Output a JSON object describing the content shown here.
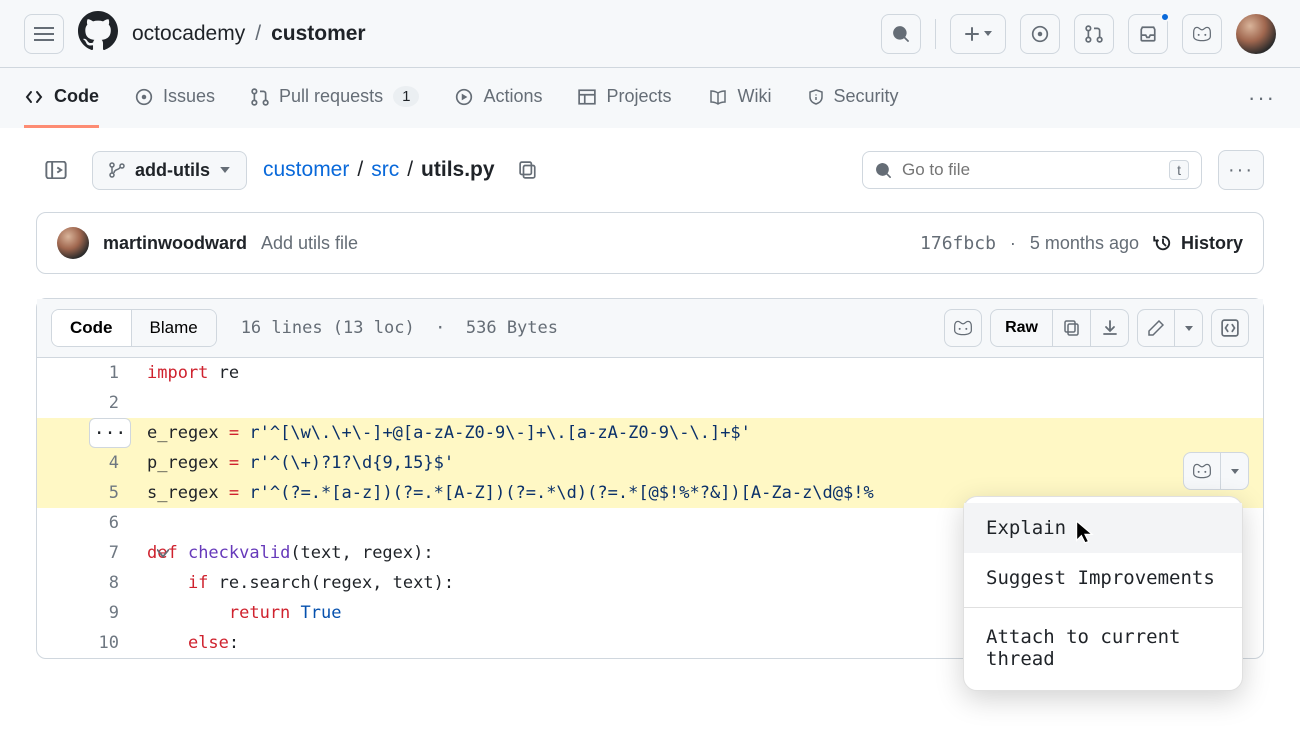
{
  "header": {
    "owner": "octocademy",
    "repo": "customer"
  },
  "tabs": {
    "code": "Code",
    "issues": "Issues",
    "pull_requests": "Pull requests",
    "pr_count": "1",
    "actions": "Actions",
    "projects": "Projects",
    "wiki": "Wiki",
    "security": "Security"
  },
  "file_bar": {
    "branch": "add-utils",
    "path_repo": "customer",
    "path_dir": "src",
    "path_file": "utils.py",
    "goto_placeholder": "Go to file",
    "goto_kbd": "t"
  },
  "commit": {
    "author": "martinwoodward",
    "message": "Add utils file",
    "sha": "176fbcb",
    "ago": "5 months ago",
    "history": "History"
  },
  "codebar": {
    "code_tab": "Code",
    "blame_tab": "Blame",
    "stats_lines": "16 lines (13 loc)",
    "stats_bytes": "536 Bytes",
    "raw": "Raw"
  },
  "code": {
    "l1_import": "import ",
    "l1_re": "re",
    "l3": "e_regex = r'^[\\w\\.\\+\\-]+@[a-zA-Z0-9\\-]+\\.[a-zA-Z0-9\\-\\.]+$'",
    "l4": "p_regex = r'^(\\+)?1?\\d{9,15}$'",
    "l5": "s_regex = r'^(?=.*[a-z])(?=.*[A-Z])(?=.*\\d)(?=.*[@$!%*?&])[A-Za-z\\d@$!%",
    "l7_def": "def ",
    "l7_name": "checkvalid",
    "l7_rest": "(text, regex):",
    "l8_if": "    if ",
    "l8_rest": "re.search(regex, text):",
    "l9_ret": "        return ",
    "l9_true": "True",
    "l10": "    else:"
  },
  "menu": {
    "explain": "Explain",
    "suggest": "Suggest Improvements",
    "attach": "Attach to current thread"
  }
}
